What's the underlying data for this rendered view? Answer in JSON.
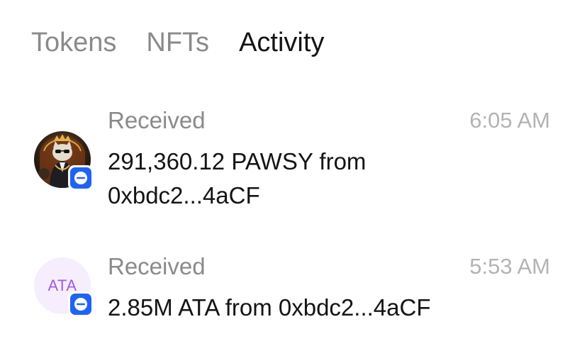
{
  "tabs": [
    {
      "label": "Tokens",
      "active": false
    },
    {
      "label": "NFTs",
      "active": false
    },
    {
      "label": "Activity",
      "active": true
    }
  ],
  "activity": [
    {
      "title": "Received",
      "time": "6:05 AM",
      "description": "291,360.12 PAWSY from 0xbdc2...4aCF",
      "avatar": "cat-nft-image",
      "badge_icon": "base-chain-icon"
    },
    {
      "title": "Received",
      "time": "5:53 AM",
      "description": "2.85M ATA from 0xbdc2...4aCF",
      "avatar_text": "ATA",
      "badge_icon": "base-chain-icon"
    }
  ],
  "colors": {
    "active_tab": "#141414",
    "inactive_tab": "#8a8a8a",
    "time": "#b3b3b3",
    "badge": "#1f63f2",
    "ata_avatar_bg": "#f6eefc",
    "ata_avatar_text": "#9b5de5"
  }
}
